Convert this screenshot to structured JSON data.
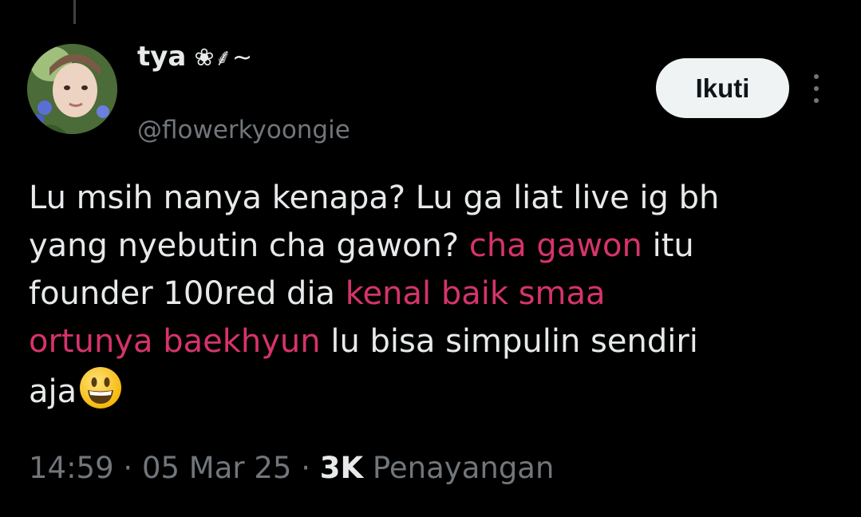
{
  "user": {
    "display_name": "tya",
    "name_decoration": "❀⸙~",
    "handle": "@flowerkyoongie"
  },
  "actions": {
    "follow_label": "Ikuti"
  },
  "tweet": {
    "lines": [
      [
        {
          "text": "Lu msih nanya kenapa? Lu ga liat live ig bh",
          "highlight": false
        }
      ],
      [
        {
          "text": "yang nyebutin cha gawon? ",
          "highlight": false
        },
        {
          "text": "cha gawon",
          "highlight": true
        },
        {
          "text": " itu",
          "highlight": false
        }
      ],
      [
        {
          "text": "founder 100red dia ",
          "highlight": false
        },
        {
          "text": "kenal baik smaa",
          "highlight": true
        }
      ],
      [
        {
          "text": "ortunya baekhyun",
          "highlight": true
        },
        {
          "text": " lu bisa simpulin sendiri",
          "highlight": false
        }
      ],
      [
        {
          "text": "aja",
          "highlight": false
        }
      ]
    ],
    "trailing_emoji": "grinning-face-emoji"
  },
  "meta": {
    "time": "14:59",
    "date": "05 Mar 25",
    "separator": "·",
    "views_count": "3K",
    "views_label": "Penayangan"
  },
  "colors": {
    "background": "#000000",
    "text": "#e7e9ea",
    "muted": "#71767b",
    "highlight": "#d6336c",
    "button_bg": "#eff3f4"
  }
}
